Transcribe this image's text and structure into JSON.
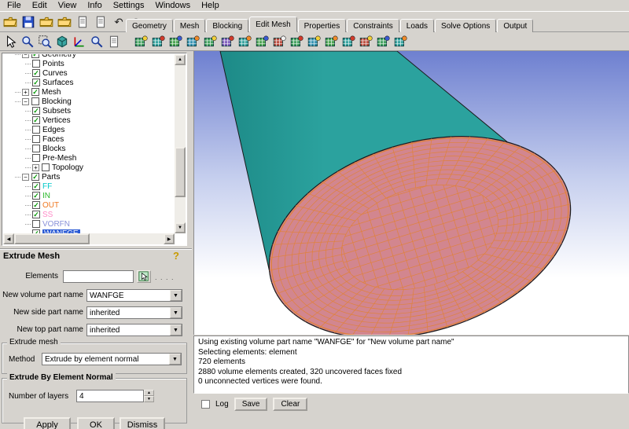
{
  "menu": {
    "items": [
      "File",
      "Edit",
      "View",
      "Info",
      "Settings",
      "Windows",
      "Help"
    ]
  },
  "tabs": [
    {
      "label": "Geometry"
    },
    {
      "label": "Mesh"
    },
    {
      "label": "Blocking"
    },
    {
      "label": "Edit Mesh",
      "active": true
    },
    {
      "label": "Properties"
    },
    {
      "label": "Constraints"
    },
    {
      "label": "Loads"
    },
    {
      "label": "Solve Options"
    },
    {
      "label": "Output"
    }
  ],
  "toolbar_file": {
    "icons": [
      {
        "name": "open-project-icon",
        "glyph": "folder"
      },
      {
        "name": "save-project-icon",
        "glyph": "floppy"
      },
      {
        "name": "open-geometry-icon",
        "glyph": "folder"
      },
      {
        "name": "open-mesh-icon",
        "glyph": "folder"
      },
      {
        "name": "save-geometry-icon",
        "glyph": "doc"
      },
      {
        "name": "save-mesh-icon",
        "glyph": "doc"
      },
      {
        "name": "undo-icon",
        "glyph": "undo"
      },
      {
        "name": "redo-icon",
        "glyph": "redo"
      }
    ]
  },
  "toolbar_view": {
    "icons": [
      {
        "name": "select-cursor-icon",
        "glyph": "cursor"
      },
      {
        "name": "zoom-window-icon",
        "glyph": "magnifier"
      },
      {
        "name": "fit-window-icon",
        "glyph": "magbox"
      },
      {
        "name": "isometric-view-icon",
        "glyph": "cube"
      },
      {
        "name": "coordinate-axes-icon",
        "glyph": "axes"
      },
      {
        "name": "measure-distance-icon",
        "glyph": "magnifier"
      },
      {
        "name": "screen-layout-icon",
        "glyph": "doc"
      }
    ]
  },
  "toolbar_mesh": {
    "icons": [
      {
        "name": "create-elements-icon",
        "glyph": "mesh",
        "color": "#3a9c58",
        "accent": "#f2d03a"
      },
      {
        "name": "extrude-elements-icon",
        "glyph": "mesh",
        "color": "#2f9e9a",
        "accent": "#d23a2a"
      },
      {
        "name": "smooth-elements-icon",
        "glyph": "mesh",
        "color": "#44a04a",
        "accent": "#3a5ad2"
      },
      {
        "name": "refine-elements-icon",
        "glyph": "mesh",
        "color": "#2f8fae",
        "accent": "#f08a2a"
      },
      {
        "name": "coarsen-elements-icon",
        "glyph": "mesh",
        "color": "#3a9c58",
        "accent": "#f2d03a"
      },
      {
        "name": "transform-elements-icon",
        "glyph": "mesh",
        "color": "#7a58b8",
        "accent": "#d23a2a"
      },
      {
        "name": "merge-nodes-icon",
        "glyph": "mesh",
        "color": "#2f9e9a",
        "accent": "#f08a2a"
      },
      {
        "name": "split-edges-icon",
        "glyph": "mesh",
        "color": "#44a04a",
        "accent": "#3a5ad2"
      },
      {
        "name": "repair-mesh-icon",
        "glyph": "mesh",
        "color": "#b8483a",
        "accent": "#f2f2f2"
      },
      {
        "name": "swap-edges-icon",
        "glyph": "mesh",
        "color": "#3a9c58",
        "accent": "#d23a2a"
      },
      {
        "name": "move-nodes-icon",
        "glyph": "mesh",
        "color": "#2f8fae",
        "accent": "#f2d03a"
      },
      {
        "name": "project-nodes-icon",
        "glyph": "mesh",
        "color": "#44a04a",
        "accent": "#f08a2a"
      },
      {
        "name": "renumber-mesh-icon",
        "glyph": "mesh",
        "color": "#2f9e9a",
        "accent": "#d23a2a"
      },
      {
        "name": "delete-elements-icon",
        "glyph": "mesh",
        "color": "#b8483a",
        "accent": "#f2d03a"
      },
      {
        "name": "mesh-quality-icon",
        "glyph": "mesh",
        "color": "#3a9c58",
        "accent": "#3a5ad2"
      },
      {
        "name": "check-mesh-icon",
        "glyph": "mesh",
        "color": "#2f9e9a",
        "accent": "#f08a2a"
      }
    ]
  },
  "tree": {
    "items": [
      {
        "label": "Geometry",
        "indent": 1,
        "expand": "-",
        "check": "on",
        "clipped": true
      },
      {
        "label": "Points",
        "indent": 2,
        "check": "off"
      },
      {
        "label": "Curves",
        "indent": 2,
        "check": "on"
      },
      {
        "label": "Surfaces",
        "indent": 2,
        "check": "on"
      },
      {
        "label": "Mesh",
        "indent": 1,
        "expand": "+",
        "check": "on"
      },
      {
        "label": "Blocking",
        "indent": 1,
        "expand": "-",
        "check": "off"
      },
      {
        "label": "Subsets",
        "indent": 2,
        "check": "on"
      },
      {
        "label": "Vertices",
        "indent": 2,
        "check": "on"
      },
      {
        "label": "Edges",
        "indent": 2,
        "check": "off"
      },
      {
        "label": "Faces",
        "indent": 2,
        "check": "off"
      },
      {
        "label": "Blocks",
        "indent": 2,
        "check": "off"
      },
      {
        "label": "Pre-Mesh",
        "indent": 2,
        "check": "off"
      },
      {
        "label": "Topology",
        "indent": 2,
        "expand": "+",
        "check": "off"
      },
      {
        "label": "Parts",
        "indent": 1,
        "expand": "-",
        "check": "on"
      },
      {
        "label": "FF",
        "indent": 2,
        "check": "on",
        "color": "#00c8c8"
      },
      {
        "label": "IN",
        "indent": 2,
        "check": "on",
        "color": "#2ab82a"
      },
      {
        "label": "OUT",
        "indent": 2,
        "check": "on",
        "color": "#f07820"
      },
      {
        "label": "SS",
        "indent": 2,
        "check": "on",
        "color": "#ff8cc8"
      },
      {
        "label": "VORFN",
        "indent": 2,
        "check": "off",
        "color": "#8890d8"
      },
      {
        "label": "WANFGE",
        "indent": 2,
        "check": "on",
        "selected": true
      }
    ]
  },
  "panel": {
    "title": "Extrude Mesh",
    "help_glyph": "?",
    "elements_label": "Elements",
    "elements_value": "",
    "picker_dots": ". . . .",
    "fields": [
      {
        "label": "New volume part name",
        "value": "WANFGE"
      },
      {
        "label": "New side part name",
        "value": "inherited"
      },
      {
        "label": "New top part name",
        "value": "inherited"
      }
    ],
    "extrude_group": {
      "title": "Extrude mesh",
      "method_label": "Method",
      "method_value": "Extrude by element normal"
    },
    "normal_group": {
      "title": "Extrude By Element Normal",
      "layers_label": "Number of layers",
      "layers_value": "4"
    },
    "buttons": [
      "Apply",
      "OK",
      "Dismiss"
    ]
  },
  "messages": {
    "lines": [
      "Using existing volume part name \"WANFGE\" for \"New volume part name\"",
      "Selecting elements: element",
      "720 elements",
      "2880 volume elements created, 320 uncovered faces fixed",
      "0 unconnected vertices were found."
    ],
    "log_label": "Log",
    "save_label": "Save",
    "clear_label": "Clear"
  },
  "viewport": {
    "colors": {
      "background_top": "#6e80d0",
      "background_mid": "#c6cfee",
      "background_bottom": "#ffffff",
      "cylinder": "#2ba29e",
      "cylinder_dark": "#1d8a87",
      "face": "#d2868f",
      "mesh_line": "#e0823c",
      "edge": "#1a1a1a"
    }
  }
}
